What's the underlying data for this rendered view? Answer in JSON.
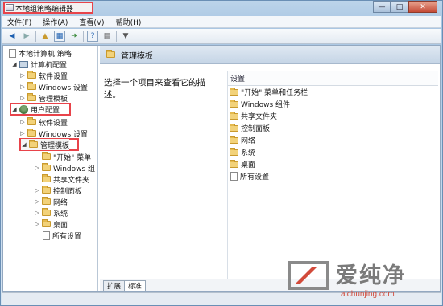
{
  "window": {
    "title": "本地组策略编辑器",
    "controls": {
      "minimize": "—",
      "maximize": "□",
      "close": "✕"
    }
  },
  "menu": [
    "文件(F)",
    "操作(A)",
    "查看(V)",
    "帮助(H)"
  ],
  "toolbar": {
    "icons": [
      "back-icon",
      "forward-icon",
      "up-icon",
      "show-tree-icon",
      "export-icon",
      "help-icon",
      "properties-icon",
      "filter-icon"
    ]
  },
  "tree": {
    "root": "本地计算机 策略",
    "computer_config": "计算机配置",
    "cc_children": [
      "软件设置",
      "Windows 设置",
      "管理模板"
    ],
    "user_config": "用户配置",
    "uc_children": [
      "软件设置",
      "Windows 设置",
      "管理模板"
    ],
    "admin_children": [
      "\"开始\" 菜单",
      "Windows 组",
      "共享文件夹",
      "控制面板",
      "网络",
      "系统",
      "桌面",
      "所有设置"
    ]
  },
  "detail": {
    "title": "管理模板",
    "description": "选择一个项目来查看它的描述。",
    "list_header": "设置",
    "items": [
      "\"开始\" 菜单和任务栏",
      "Windows 组件",
      "共享文件夹",
      "控制面板",
      "网络",
      "系统",
      "桌面",
      "所有设置"
    ]
  },
  "tabs": [
    "扩展",
    "标准"
  ],
  "watermark": {
    "brand": "爱纯净",
    "url": "aichunjing.com"
  },
  "colors": {
    "highlight_box": "#e8434a",
    "folder": "#f2d27a"
  }
}
